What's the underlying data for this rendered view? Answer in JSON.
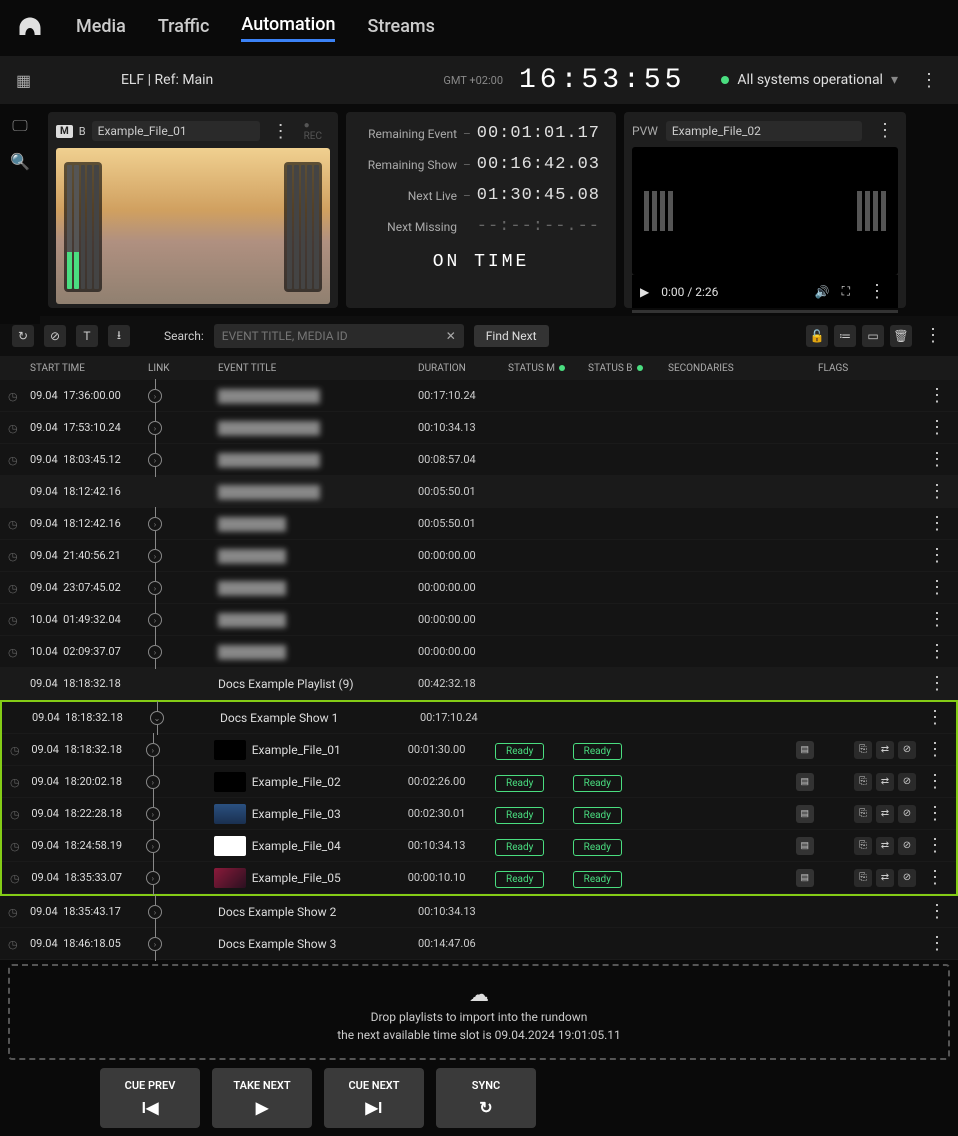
{
  "nav": {
    "items": [
      "Media",
      "Traffic",
      "Automation",
      "Streams"
    ],
    "active": 2
  },
  "header": {
    "channel": "ELF | Ref: Main",
    "timezone": "GMT +02:00",
    "clock": "16:53:55",
    "status": "All systems operational"
  },
  "pgm": {
    "badge_m": "M",
    "badge_b": "B",
    "filename": "Example_File_01",
    "rec": "REC"
  },
  "timers": {
    "remaining_event_label": "Remaining Event",
    "remaining_event": "00:01:01.17",
    "remaining_show_label": "Remaining Show",
    "remaining_show": "00:16:42.03",
    "next_live_label": "Next Live",
    "next_live": "01:30:45.08",
    "next_missing_label": "Next Missing",
    "next_missing": "--:--:--.--",
    "on_time": "ON TIME"
  },
  "pvw": {
    "label": "PVW",
    "filename": "Example_File_02",
    "position": "0:00 / 2:26"
  },
  "search": {
    "label": "Search:",
    "placeholder": "EVENT TITLE, MEDIA ID",
    "find_next": "Find Next"
  },
  "columns": {
    "start": "START TIME",
    "link": "LINK",
    "title": "EVENT TITLE",
    "duration": "DURATION",
    "status_m": "STATUS M",
    "status_b": "STATUS B",
    "secondaries": "SECONDARIES",
    "flags": "FLAGS"
  },
  "rows": [
    {
      "date": "09.04",
      "time": "17:36:00.00",
      "title": "████████████",
      "blur": true,
      "dur": "00:17:10.24",
      "clock": true,
      "link": true
    },
    {
      "date": "09.04",
      "time": "17:53:10.24",
      "title": "████████████",
      "blur": true,
      "dur": "00:10:34.13",
      "clock": true,
      "link": true
    },
    {
      "date": "09.04",
      "time": "18:03:45.12",
      "title": "████████████",
      "blur": true,
      "dur": "00:08:57.04",
      "clock": true,
      "link": true
    },
    {
      "date": "09.04",
      "time": "18:12:42.16",
      "title": "████████████",
      "blur": true,
      "dur": "00:05:50.01",
      "clock": false,
      "link": false,
      "alt": true
    },
    {
      "date": "09.04",
      "time": "18:12:42.16",
      "title": "████████",
      "blur": true,
      "dur": "00:05:50.01",
      "clock": true,
      "link": true
    },
    {
      "date": "09.04",
      "time": "21:40:56.21",
      "title": "████████",
      "blur": true,
      "dur": "00:00:00.00",
      "clock": true,
      "link": true
    },
    {
      "date": "09.04",
      "time": "23:07:45.02",
      "title": "████████",
      "blur": true,
      "dur": "00:00:00.00",
      "clock": true,
      "link": true
    },
    {
      "date": "10.04",
      "time": "01:49:32.04",
      "title": "████████",
      "blur": true,
      "dur": "00:00:00.00",
      "clock": true,
      "link": true
    },
    {
      "date": "10.04",
      "time": "02:09:37.07",
      "title": "████████",
      "blur": true,
      "dur": "00:00:00.00",
      "clock": true,
      "link": true
    },
    {
      "date": "09.04",
      "time": "18:18:32.18",
      "title": "Docs Example Playlist (9)",
      "dur": "00:42:32.18",
      "clock": false,
      "link": false,
      "alt": true
    },
    {
      "date": "09.04",
      "time": "18:18:32.18",
      "title": "Docs Example Show 1",
      "dur": "00:17:10.24",
      "clock": false,
      "link": true,
      "hl": true,
      "expand": true
    },
    {
      "date": "09.04",
      "time": "18:18:32.18",
      "title": "Example_File_01",
      "dur": "00:01:30.00",
      "clock": true,
      "link": true,
      "hl": true,
      "ready": true,
      "thumb": "c1",
      "flags": true
    },
    {
      "date": "09.04",
      "time": "18:20:02.18",
      "title": "Example_File_02",
      "dur": "00:02:26.00",
      "clock": true,
      "link": true,
      "hl": true,
      "ready": true,
      "thumb": "c1",
      "flags": true
    },
    {
      "date": "09.04",
      "time": "18:22:28.18",
      "title": "Example_File_03",
      "dur": "00:02:30.01",
      "clock": true,
      "link": true,
      "hl": true,
      "ready": true,
      "thumb": "c2",
      "flags": true
    },
    {
      "date": "09.04",
      "time": "18:24:58.19",
      "title": "Example_File_04",
      "dur": "00:10:34.13",
      "clock": true,
      "link": true,
      "hl": true,
      "ready": true,
      "thumb": "c3",
      "flags": true
    },
    {
      "date": "09.04",
      "time": "18:35:33.07",
      "title": "Example_File_05",
      "dur": "00:00:10.10",
      "clock": true,
      "link": true,
      "hl": true,
      "ready": true,
      "thumb": "c4",
      "flags": true
    },
    {
      "date": "09.04",
      "time": "18:35:43.17",
      "title": "Docs Example Show 2",
      "dur": "00:10:34.13",
      "clock": true,
      "link": true
    },
    {
      "date": "09.04",
      "time": "18:46:18.05",
      "title": "Docs Example Show 3",
      "dur": "00:14:47.06",
      "clock": true,
      "link": true
    }
  ],
  "ready_label": "Ready",
  "dropzone": {
    "line1": "Drop playlists to import into the rundown",
    "line2": "the next available time slot is 09.04.2024 19:01:05.11"
  },
  "controls": {
    "cue_prev": "CUE PREV",
    "take_next": "TAKE NEXT",
    "cue_next": "CUE NEXT",
    "sync": "SYNC"
  }
}
